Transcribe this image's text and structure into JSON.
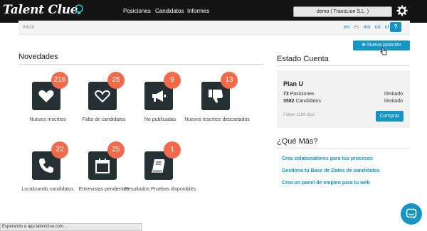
{
  "header": {
    "logo_text": "Talent Clue",
    "nav": [
      "Posiciones",
      "Candidatos",
      "Informes"
    ],
    "account": "demo ( TransLion S.L. )"
  },
  "breadcrumb": {
    "home": "Inicio",
    "languages": [
      "en",
      "es",
      "mx",
      "co",
      "cl"
    ],
    "help_label": "?"
  },
  "actions": {
    "new_position": "Nueva posición"
  },
  "novedades": {
    "title": "Novedades",
    "tiles": [
      {
        "label": "Nuevos inscritos",
        "count": "216",
        "icon": "heart-filled-icon"
      },
      {
        "label": "Falta de candidatos",
        "count": "25",
        "icon": "heart-outline-icon"
      },
      {
        "label": "No publicadas",
        "count": "9",
        "icon": "megaphone-icon"
      },
      {
        "label": "Nuevos inscritos descartados",
        "count": "13",
        "icon": "thumbs-down-icon"
      },
      {
        "label": "Localizando candidatos",
        "count": "22",
        "icon": "phone-icon"
      },
      {
        "label": "Entrevistas pendientes",
        "count": "25",
        "icon": "calendar-icon"
      },
      {
        "label": "Resultados Pruebas disponibles",
        "count": "1",
        "icon": "book-icon"
      }
    ]
  },
  "estado": {
    "title": "Estado Cuenta",
    "plan": "Plan U",
    "rows": [
      {
        "count": "73",
        "label": "Posiciones",
        "value": "Ilimitado"
      },
      {
        "count": "3582",
        "label": "Candidatos",
        "value": "Ilimitado"
      }
    ],
    "remaining": "Faltan 1194 días",
    "buy": "Comprar"
  },
  "que_mas": {
    "title": "¿Qué Más?",
    "links": [
      "Crea colaboradores para tus procesos",
      "Gestiona tu Base de Datos de candidatos",
      "Crea un panel de empleo para tu web"
    ]
  },
  "status_bar": "Esperando a app.talentclue.com...",
  "colors": {
    "accent": "#1595c4",
    "badge": "#f26a4a",
    "tile": "#243033",
    "topbar": "#141414"
  }
}
